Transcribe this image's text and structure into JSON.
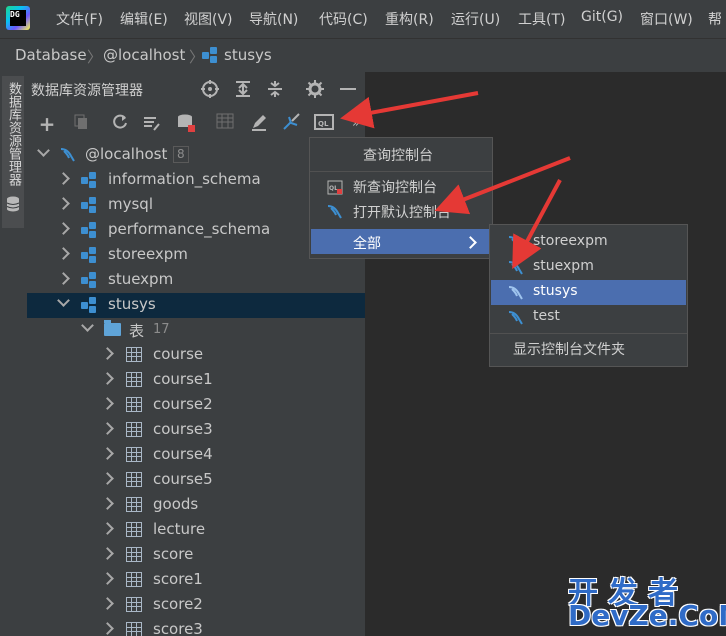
{
  "app": {
    "logo_text": "DG"
  },
  "menu": [
    "文件(F)",
    "编辑(E)",
    "视图(V)",
    "导航(N)",
    "代码(C)",
    "重构(R)",
    "运行(U)",
    "工具(T)",
    "Git(G)",
    "窗口(W)",
    "帮"
  ],
  "breadcrumb": [
    "Database",
    "@localhost",
    "stusys"
  ],
  "sidebar_tab": "数据库资源管理器",
  "tool_window": {
    "title": "数据库资源管理器"
  },
  "tree": {
    "root": {
      "label": "@localhost",
      "badge": "8"
    },
    "schemas": [
      "information_schema",
      "mysql",
      "performance_schema",
      "storeexpm",
      "stuexpm",
      "stusys"
    ],
    "selected_schema": "stusys",
    "folder": {
      "label": "表",
      "count": "17"
    },
    "tables": [
      "course",
      "course1",
      "course2",
      "course3",
      "course4",
      "course5",
      "goods",
      "lecture",
      "score",
      "score1",
      "score2",
      "score3"
    ]
  },
  "popup_console": {
    "header": "查询控制台",
    "items": [
      "新查询控制台",
      "打开默认控制台"
    ],
    "submenu_label": "全部"
  },
  "popup_all": {
    "items": [
      "storeexpm",
      "stuexpm",
      "stusys",
      "test"
    ],
    "selected": "stusys",
    "footer": "显示控制台文件夹"
  },
  "watermark": {
    "line1": "开发者",
    "line2": "DevZe.CoM"
  },
  "colors": {
    "selection": "#4b6eaf",
    "tree_selection": "#0d293e",
    "arrow": "#e53935",
    "schema_icon": "#3d8fd1"
  }
}
